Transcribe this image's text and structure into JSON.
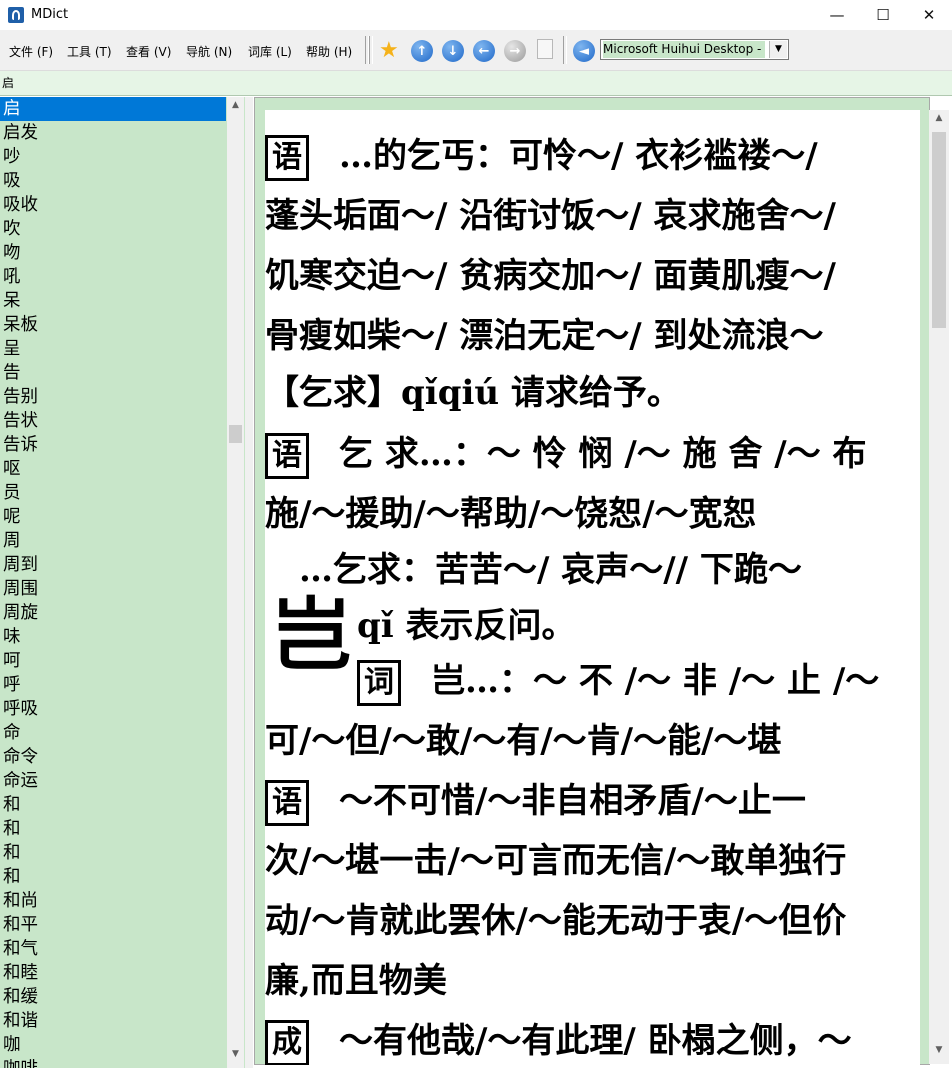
{
  "window": {
    "title": "MDict"
  },
  "menu": [
    "文件 (F)",
    "工具 (T)",
    "查看 (V)",
    "导航 (N)",
    "词库 (L)",
    "帮助 (H)"
  ],
  "toolbar": {
    "icons": [
      "favorite-star-icon",
      "arrow-up-icon",
      "arrow-down-icon",
      "arrow-left-icon",
      "arrow-right-icon",
      "document-icon",
      "speaker-icon"
    ],
    "voice_select": "Microsoft Huihui Desktop - C"
  },
  "search": {
    "value": "启"
  },
  "wordlist": {
    "selected_index": 0,
    "items": [
      "启",
      "启发",
      "吵",
      "吸",
      "吸收",
      "吹",
      "吻",
      "吼",
      "呆",
      "呆板",
      "呈",
      "告",
      "告别",
      "告状",
      "告诉",
      "呕",
      "员",
      "呢",
      "周",
      "周到",
      "周围",
      "周旋",
      "味",
      "呵",
      "呼",
      "呼吸",
      "命",
      "命令",
      "命运",
      "和",
      "和",
      "和",
      "和",
      "和尚",
      "和平",
      "和气",
      "和睦",
      "和缓",
      "和谐",
      "咖",
      "咖啡"
    ]
  },
  "content": {
    "lines": [
      {
        "tag": "语",
        "text": "…的乞丐：可怜～/ 衣衫褴褛～/"
      },
      {
        "tag": "",
        "text": "蓬头垢面～/ 沿街讨饭～/ 哀求施舍～/"
      },
      {
        "tag": "",
        "text": "饥寒交迫～/ 贫病交加～/ 面黄肌瘦～/"
      },
      {
        "tag": "",
        "text": "骨瘦如柴～/ 漂泊无定～/ 到处流浪～"
      },
      {
        "tag": "",
        "text": "【乞求】qǐqiú 请求给予。"
      },
      {
        "tag": "语",
        "text": "乞 求…：～ 怜 悯 /～ 施 舍 /～ 布"
      },
      {
        "tag": "",
        "text": "施/～援助/～帮助/～饶恕/～宽恕"
      },
      {
        "tag": "",
        "text": "　…乞求：苦苦～/ 哀声～// 下跪～"
      },
      {
        "tag": "",
        "text": "qǐ 表示反问。"
      },
      {
        "tag": "词",
        "text": "岂…：～ 不 /～ 非 /～ 止 /～"
      },
      {
        "tag": "",
        "text": "可/～但/～敢/～有/～肯/～能/～堪"
      },
      {
        "tag": "语",
        "text": "～不可惜/～非自相矛盾/～止一"
      },
      {
        "tag": "",
        "text": "次/～堪一击/～可言而无信/～敢单独行"
      },
      {
        "tag": "",
        "text": "动/～肯就此罢休/～能无动于衷/～但价"
      },
      {
        "tag": "",
        "text": "廉,而且物美"
      },
      {
        "tag": "成",
        "text": "～有他哉/～有此理/ 卧榻之侧，～"
      }
    ],
    "headword_char": "岂"
  },
  "colors": {
    "accent": "#0078d7",
    "panel": "#c8e6c9"
  }
}
